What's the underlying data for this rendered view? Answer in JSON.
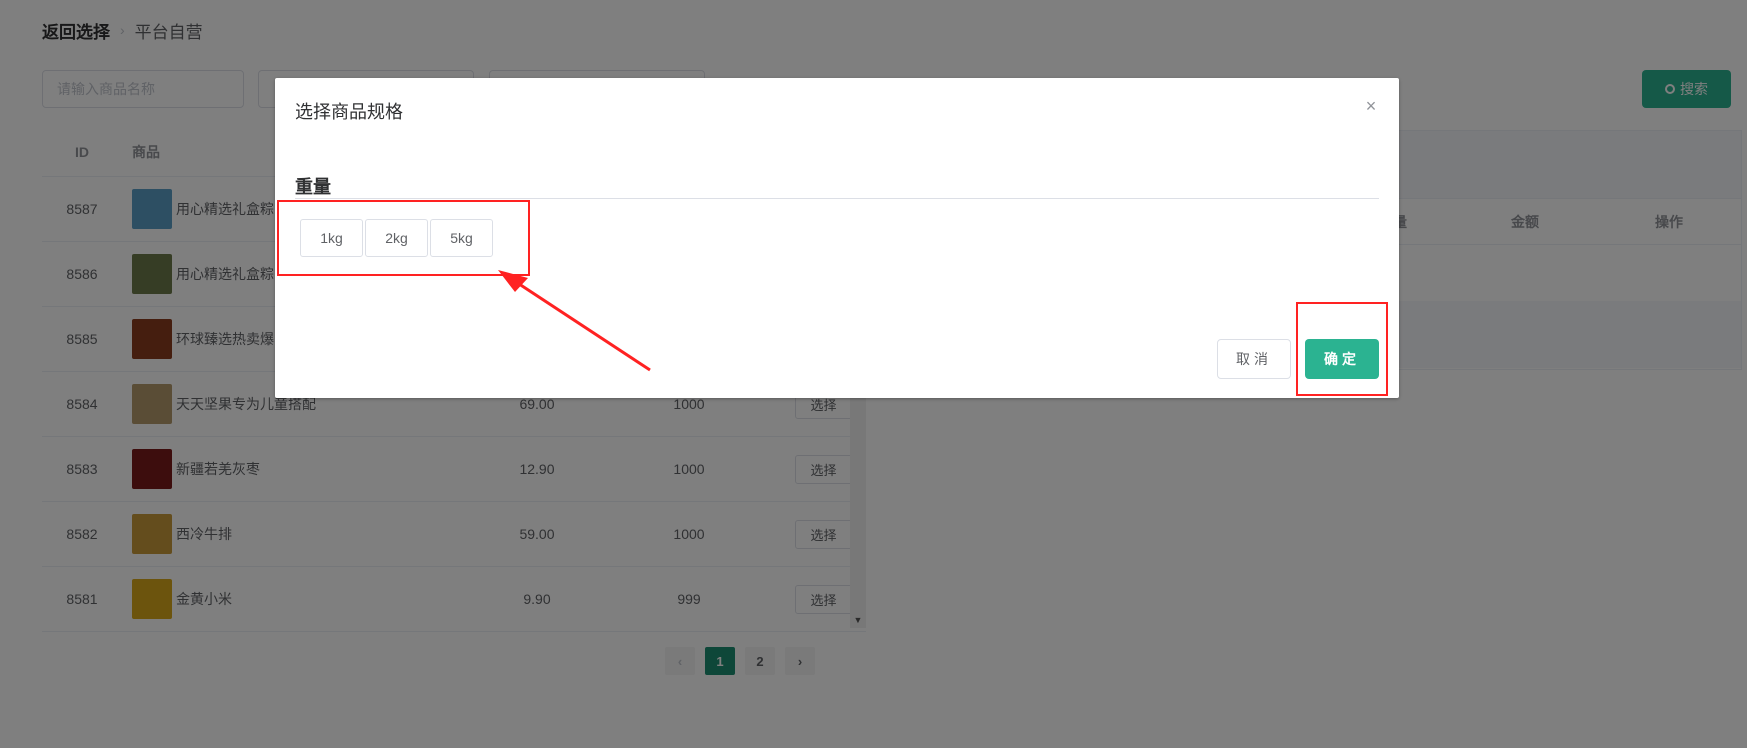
{
  "breadcrumb": {
    "back": "返回选择",
    "separator": "›",
    "current": "平台自营"
  },
  "filters": {
    "name_placeholder": "请输入商品名称",
    "search_label": "搜索"
  },
  "table": {
    "headers": {
      "id": "ID",
      "goods": "商品"
    },
    "rows": [
      {
        "id": "8587",
        "name": "用心精选礼盒粽",
        "price": "",
        "stock": "",
        "action": "",
        "thumb_color": "#5a9fc6"
      },
      {
        "id": "8586",
        "name": "用心精选礼盒粽",
        "price": "",
        "stock": "",
        "action": "",
        "thumb_color": "#6d7a4a"
      },
      {
        "id": "8585",
        "name": "环球臻选热卖爆",
        "price": "",
        "stock": "",
        "action": "",
        "thumb_color": "#8a3d1e"
      },
      {
        "id": "8584",
        "name": "天天坚果专为儿童搭配",
        "price": "69.00",
        "stock": "1000",
        "action": "选择",
        "thumb_color": "#b59b6c"
      },
      {
        "id": "8583",
        "name": "新疆若羌灰枣",
        "price": "12.90",
        "stock": "1000",
        "action": "选择",
        "thumb_color": "#7a1a1a"
      },
      {
        "id": "8582",
        "name": "西冷牛排",
        "price": "59.00",
        "stock": "1000",
        "action": "选择",
        "thumb_color": "#c89a3a"
      },
      {
        "id": "8581",
        "name": "金黄小米",
        "price": "9.90",
        "stock": "999",
        "action": "选择",
        "thumb_color": "#d9a81a"
      }
    ]
  },
  "right_panel": {
    "col_partial": "量",
    "col_amount": "金额",
    "col_action": "操作"
  },
  "pagination": {
    "prev": "‹",
    "pages": [
      "1",
      "2"
    ],
    "current": "1",
    "next": "›"
  },
  "dialog": {
    "title": "选择商品规格",
    "close": "×",
    "spec_name": "重量",
    "options": [
      "1kg",
      "2kg",
      "5kg"
    ],
    "cancel": "取消",
    "confirm": "确定"
  },
  "colors": {
    "accent": "#2bb391",
    "annotation": "#ff2222"
  }
}
